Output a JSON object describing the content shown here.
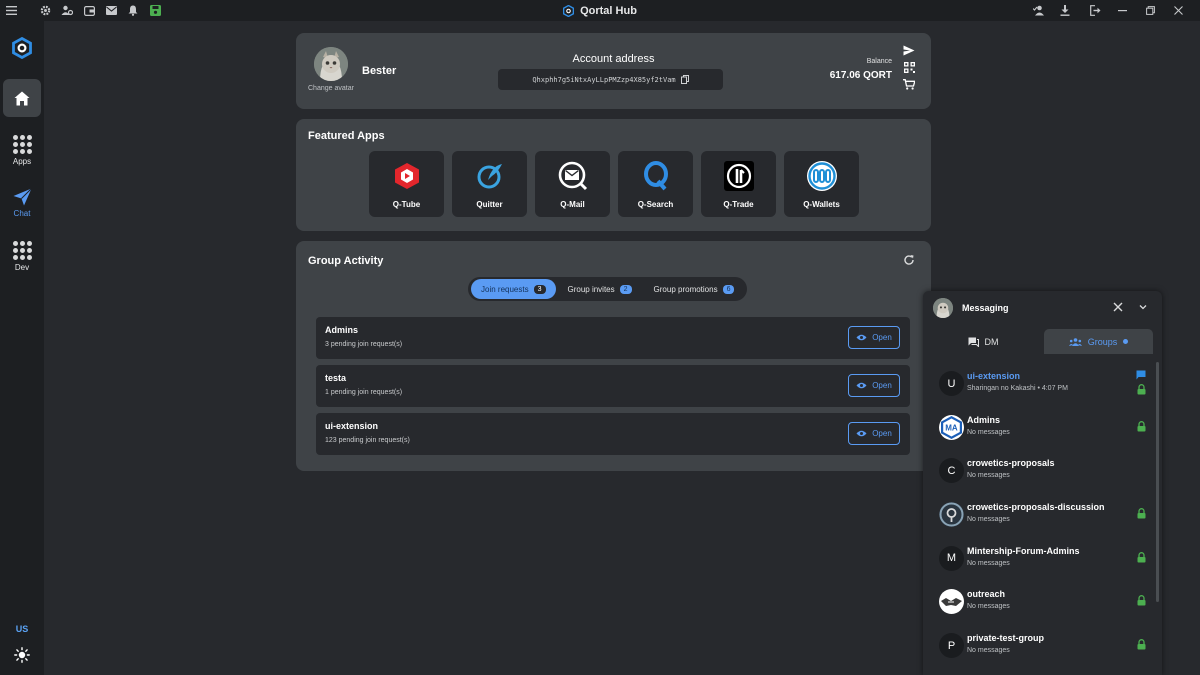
{
  "app": {
    "title": "Qortal Hub"
  },
  "titlebar": {
    "left_icons": [
      "menu-icon",
      "settings-icon",
      "users-icon",
      "wallet-icon",
      "mail-icon",
      "bell-icon",
      "save-icon"
    ],
    "right_icons": [
      "user-check-icon",
      "download-icon",
      "logout-icon",
      "minimize-icon",
      "restore-icon",
      "close-icon"
    ]
  },
  "sidebar": {
    "items": [
      {
        "label": "",
        "icon": "home-icon"
      },
      {
        "label": "Apps",
        "icon": "apps-grid-icon"
      },
      {
        "label": "Chat",
        "icon": "send-icon"
      },
      {
        "label": "Dev",
        "icon": "dev-grid-icon"
      }
    ],
    "language": "US",
    "theme_icon": "sun-icon"
  },
  "account": {
    "name": "Bester",
    "change_avatar": "Change avatar",
    "address_label": "Account address",
    "address": "Qhxphh7g5iNtxAyLLpPMZzp4X85yf2tVam",
    "balance_label": "Balance",
    "balance": "617.06 QORT"
  },
  "featured": {
    "title": "Featured Apps",
    "apps": [
      {
        "label": "Q-Tube",
        "icon": "q-tube-icon"
      },
      {
        "label": "Quitter",
        "icon": "quitter-icon"
      },
      {
        "label": "Q-Mail",
        "icon": "q-mail-icon"
      },
      {
        "label": "Q-Search",
        "icon": "q-search-icon"
      },
      {
        "label": "Q-Trade",
        "icon": "q-trade-icon"
      },
      {
        "label": "Q-Wallets",
        "icon": "q-wallets-icon"
      }
    ]
  },
  "group_activity": {
    "title": "Group Activity",
    "tabs": [
      {
        "label": "Join requests",
        "count": "3"
      },
      {
        "label": "Group invites",
        "count": "2"
      },
      {
        "label": "Group promotions",
        "count": "6"
      }
    ],
    "requests": [
      {
        "name": "Admins",
        "sub": "3 pending join request(s)",
        "button": "Open"
      },
      {
        "name": "testa",
        "sub": "1 pending join request(s)",
        "button": "Open"
      },
      {
        "name": "ui-extension",
        "sub": "123 pending join request(s)",
        "button": "Open"
      }
    ]
  },
  "messaging": {
    "title": "Messaging",
    "tabs": {
      "dm": "DM",
      "groups": "Groups"
    },
    "groups": [
      {
        "initial": "U",
        "name": "ui-extension",
        "sub": "Sharingan no Kakashi • 4:07 PM"
      },
      {
        "initial": "MA",
        "name": "Admins",
        "sub": "No messages"
      },
      {
        "initial": "C",
        "name": "crowetics-proposals",
        "sub": "No messages"
      },
      {
        "initial": "",
        "name": "crowetics-proposals-discussion",
        "sub": "No messages"
      },
      {
        "initial": "M",
        "name": "Mintership-Forum-Admins",
        "sub": "No messages"
      },
      {
        "initial": "",
        "name": "outreach",
        "sub": "No messages"
      },
      {
        "initial": "P",
        "name": "private-test-group",
        "sub": "No messages"
      }
    ]
  },
  "colors": {
    "accent": "#5a9bf3",
    "panel": "#3f4347",
    "background": "#27292d",
    "lock": "#4caf50"
  }
}
